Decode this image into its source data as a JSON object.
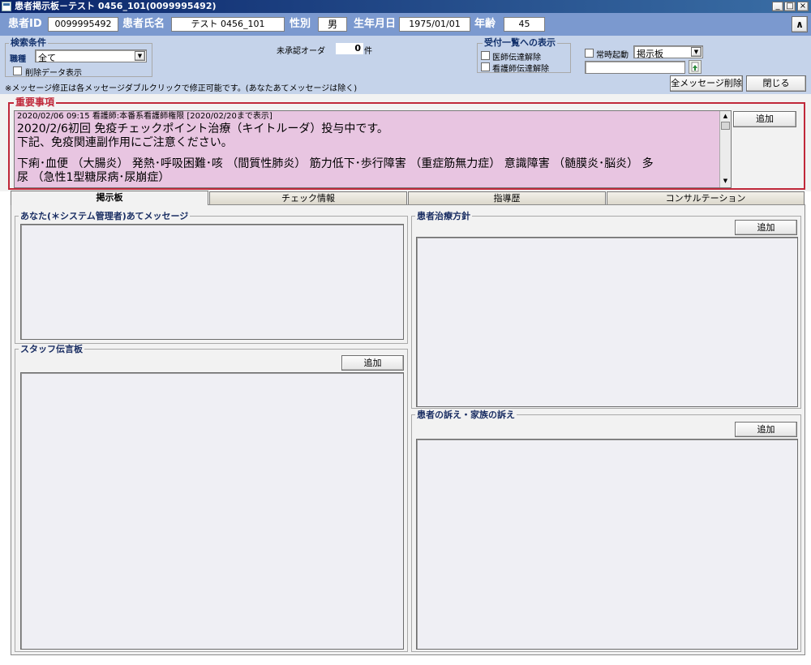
{
  "window": {
    "title": "患者掲示板－テスト 0456_101(0099995492)",
    "controls": {
      "minimize": "_",
      "maximize": "□",
      "close": "×"
    }
  },
  "patient_header": {
    "id_label": "患者ID",
    "id_value": "0099995492",
    "name_label": "患者氏名",
    "name_value": "テスト 0456_101",
    "sex_label": "性別",
    "sex_value": "男",
    "dob_label": "生年月日",
    "dob_value": "1975/01/01",
    "age_label": "年齢",
    "age_value": "45",
    "collapse_button": "∧"
  },
  "search": {
    "group_label": "検索条件",
    "role_label": "職種",
    "role_selected": "全て",
    "show_deleted_label": "削除データ表示",
    "note": "※メッセージ修正は各メッセージダブルクリックで修正可能です。(あなたあてメッセージは除く)"
  },
  "unapproved": {
    "label": "未承認オーダ",
    "count": "0",
    "unit": "件"
  },
  "reception": {
    "group_label": "受付一覧への表示",
    "doctor_label": "医師伝達解除",
    "nurse_label": "看護師伝達解除"
  },
  "startup": {
    "always_start_label": "常時起動",
    "board_selected": "掲示板"
  },
  "actions": {
    "delete_all": "全メッセージ削除",
    "close": "閉じる"
  },
  "important": {
    "label": "重要事項",
    "header": "2020/02/06 09:15 看護師:本番系看護師権限 [2020/02/20まで表示]",
    "line1": "2020/2/6初回 免疫チェックポイント治療（キイトルーダ）投与中です。",
    "line2": "下記、免疫関連副作用にご注意ください。",
    "line3": "下痢･血便 （大腸炎） 発熱･呼吸困難･咳 （間質性肺炎） 筋力低下･歩行障害 （重症筋無力症） 意識障害 （髄膜炎･脳炎） 多",
    "line4": "尿 （急性1型糖尿病･尿崩症）",
    "add_button": "追加"
  },
  "tabs": [
    {
      "label": "掲示板"
    },
    {
      "label": "チェック情報"
    },
    {
      "label": "指導歴"
    },
    {
      "label": "コンサルテーション"
    }
  ],
  "panels": {
    "to_you": {
      "title": "あなた(＊システム管理者)あてメッセージ"
    },
    "staff": {
      "title": "スタッフ伝言板",
      "add_button": "追加"
    },
    "policy": {
      "title": "患者治療方針",
      "add_button": "追加"
    },
    "complaints": {
      "title": "患者の訴え・家族の訴え",
      "add_button": "追加"
    }
  },
  "colors": {
    "title_bar": "#0a246a",
    "header_band": "#7b99cf",
    "control_band": "#c5d3ea",
    "important_bg": "#e8c5e1",
    "important_border": "#c0283a",
    "label_red": "#c0283a"
  },
  "icons": {
    "window": "window-icon",
    "refresh": "refresh-icon"
  }
}
